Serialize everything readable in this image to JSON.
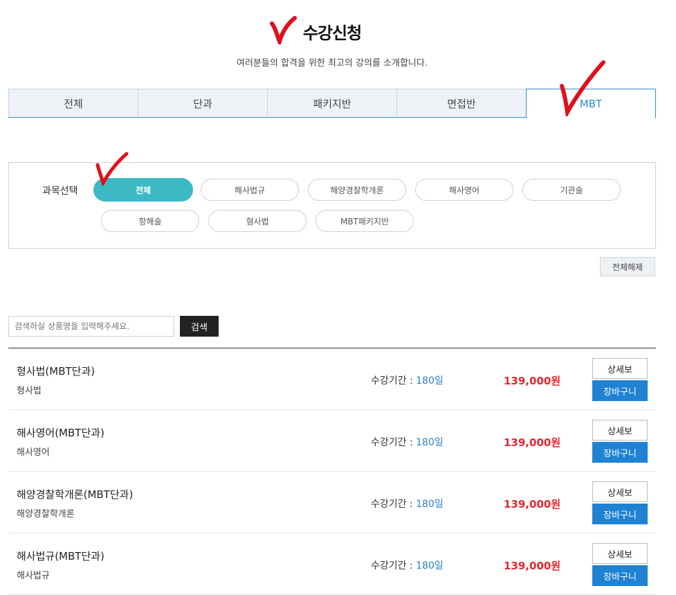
{
  "header": {
    "title": "수강신청",
    "subtitle": "여러분들의 합격을 위한 최고의 강의를 소개합니다."
  },
  "tabs": [
    {
      "label": "전체",
      "active": false
    },
    {
      "label": "단과",
      "active": false
    },
    {
      "label": "패키지반",
      "active": false
    },
    {
      "label": "면접반",
      "active": false
    },
    {
      "label": "MBT",
      "active": true
    }
  ],
  "filter": {
    "label": "과목선택",
    "chips": [
      {
        "label": "전체",
        "active": true
      },
      {
        "label": "해사법규",
        "active": false
      },
      {
        "label": "해양경찰학개론",
        "active": false
      },
      {
        "label": "해사영어",
        "active": false
      },
      {
        "label": "기관술",
        "active": false
      },
      {
        "label": "항해술",
        "active": false
      },
      {
        "label": "형사법",
        "active": false
      },
      {
        "label": "MBT패키지반",
        "active": false
      }
    ],
    "reset_label": "전체해제"
  },
  "search": {
    "placeholder": "검색하실 상품명을 입력해주세요.",
    "button_label": "검색"
  },
  "products": [
    {
      "name": "형사법(MBT단과)",
      "subject": "형사법",
      "period_label": "수강기간 : ",
      "period_days": "180일",
      "price": "139,000원",
      "detail_label": "상세보",
      "cart_label": "장바구니"
    },
    {
      "name": "해사영어(MBT단과)",
      "subject": "해사영어",
      "period_label": "수강기간 : ",
      "period_days": "180일",
      "price": "139,000원",
      "detail_label": "상세보",
      "cart_label": "장바구니"
    },
    {
      "name": "해양경찰학개론(MBT단과)",
      "subject": "해양경찰학개론",
      "period_label": "수강기간 : ",
      "period_days": "180일",
      "price": "139,000원",
      "detail_label": "상세보",
      "cart_label": "장바구니"
    },
    {
      "name": "해사법규(MBT단과)",
      "subject": "해사법규",
      "period_label": "수강기간 : ",
      "period_days": "180일",
      "price": "139,000원",
      "detail_label": "상세보",
      "cart_label": "장바구니"
    }
  ],
  "colors": {
    "accent": "#2b8fd6",
    "chip_active": "#3bbac4",
    "price": "#e8262d",
    "cart_button": "#1f82d3",
    "annotation": "#e0101a"
  },
  "icons": [
    "red-check-mark-icon"
  ]
}
